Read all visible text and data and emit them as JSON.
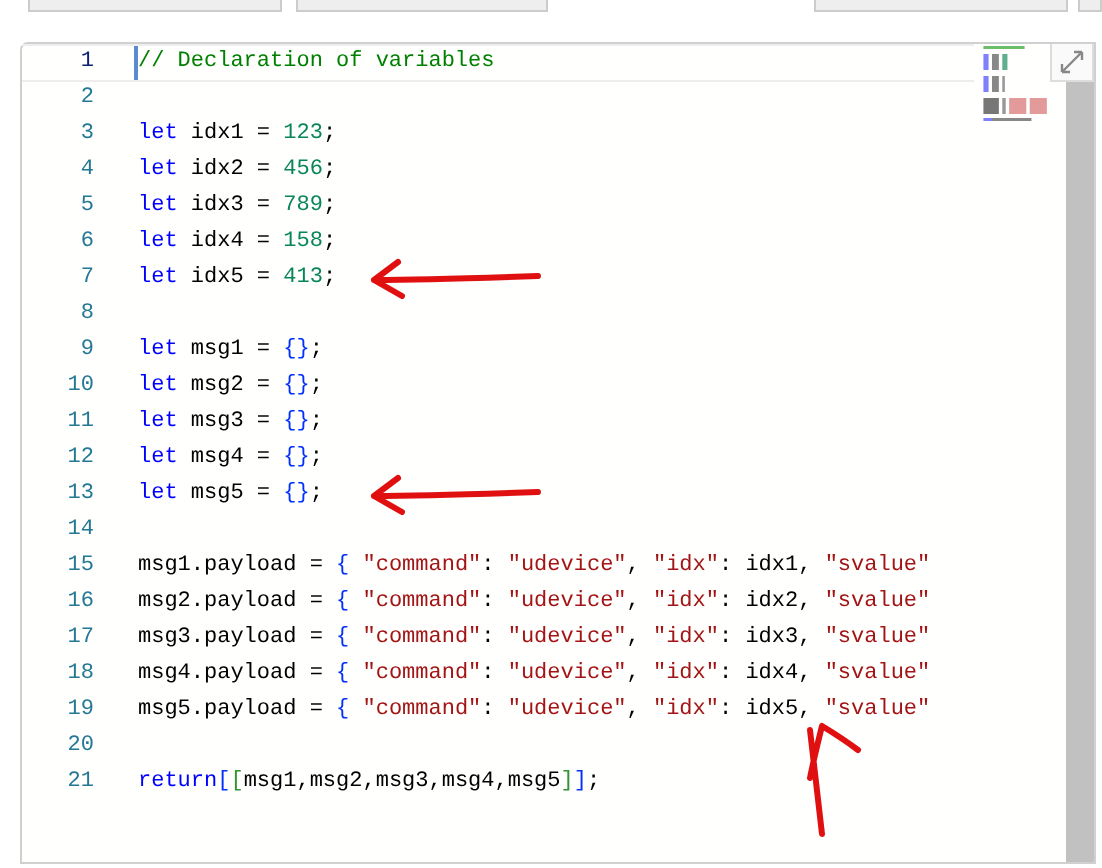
{
  "editor": {
    "lines": [
      {
        "number": "1",
        "active": true,
        "tokens": [
          {
            "kind": "comment",
            "text": "// Declaration of variables"
          }
        ]
      },
      {
        "number": "2",
        "active": false
      },
      {
        "number": "3",
        "active": false,
        "tokens": [
          {
            "kind": "keyword",
            "text": "let"
          },
          {
            "kind": "plain",
            "text": " idx1 = "
          },
          {
            "kind": "number",
            "text": "123"
          },
          {
            "kind": "plain",
            "text": ";"
          }
        ]
      },
      {
        "number": "4",
        "active": false,
        "tokens": [
          {
            "kind": "keyword",
            "text": "let"
          },
          {
            "kind": "plain",
            "text": " idx2 = "
          },
          {
            "kind": "number",
            "text": "456"
          },
          {
            "kind": "plain",
            "text": ";"
          }
        ]
      },
      {
        "number": "5",
        "active": false,
        "tokens": [
          {
            "kind": "keyword",
            "text": "let"
          },
          {
            "kind": "plain",
            "text": " idx3 = "
          },
          {
            "kind": "number",
            "text": "789"
          },
          {
            "kind": "plain",
            "text": ";"
          }
        ]
      },
      {
        "number": "6",
        "active": false,
        "tokens": [
          {
            "kind": "keyword",
            "text": "let"
          },
          {
            "kind": "plain",
            "text": " idx4 = "
          },
          {
            "kind": "number",
            "text": "158"
          },
          {
            "kind": "plain",
            "text": ";"
          }
        ]
      },
      {
        "number": "7",
        "active": false,
        "annotation": {
          "kind": "left-arrow"
        },
        "tokens": [
          {
            "kind": "keyword",
            "text": "let"
          },
          {
            "kind": "plain",
            "text": " idx5 = "
          },
          {
            "kind": "number",
            "text": "413"
          },
          {
            "kind": "plain",
            "text": ";"
          }
        ]
      },
      {
        "number": "8",
        "active": false
      },
      {
        "number": "9",
        "active": false,
        "tokens": [
          {
            "kind": "keyword",
            "text": "let"
          },
          {
            "kind": "plain",
            "text": " msg1 = "
          },
          {
            "kind": "brace",
            "text": "{}"
          },
          {
            "kind": "plain",
            "text": ";"
          }
        ]
      },
      {
        "number": "10",
        "active": false,
        "tokens": [
          {
            "kind": "keyword",
            "text": "let"
          },
          {
            "kind": "plain",
            "text": " msg2 = "
          },
          {
            "kind": "brace",
            "text": "{}"
          },
          {
            "kind": "plain",
            "text": ";"
          }
        ]
      },
      {
        "number": "11",
        "active": false,
        "tokens": [
          {
            "kind": "keyword",
            "text": "let"
          },
          {
            "kind": "plain",
            "text": " msg3 = "
          },
          {
            "kind": "brace",
            "text": "{}"
          },
          {
            "kind": "plain",
            "text": ";"
          }
        ]
      },
      {
        "number": "12",
        "active": false,
        "tokens": [
          {
            "kind": "keyword",
            "text": "let"
          },
          {
            "kind": "plain",
            "text": " msg4 = "
          },
          {
            "kind": "brace",
            "text": "{}"
          },
          {
            "kind": "plain",
            "text": ";"
          }
        ]
      },
      {
        "number": "13",
        "active": false,
        "annotation": {
          "kind": "left-arrow"
        },
        "tokens": [
          {
            "kind": "keyword",
            "text": "let"
          },
          {
            "kind": "plain",
            "text": " msg5 = "
          },
          {
            "kind": "brace",
            "text": "{}"
          },
          {
            "kind": "plain",
            "text": ";"
          }
        ]
      },
      {
        "number": "14",
        "active": false
      },
      {
        "number": "15",
        "active": false,
        "tokens": [
          {
            "kind": "plain",
            "text": "msg1.payload = "
          },
          {
            "kind": "brace",
            "text": "{"
          },
          {
            "kind": "string",
            "text": " \"command\""
          },
          {
            "kind": "plain",
            "text": ": "
          },
          {
            "kind": "string",
            "text": "\"udevice\""
          },
          {
            "kind": "plain",
            "text": ", "
          },
          {
            "kind": "string",
            "text": "\"idx\""
          },
          {
            "kind": "plain",
            "text": ": idx1, "
          },
          {
            "kind": "string",
            "text": "\"svalue\""
          }
        ]
      },
      {
        "number": "16",
        "active": false,
        "tokens": [
          {
            "kind": "plain",
            "text": "msg2.payload = "
          },
          {
            "kind": "brace",
            "text": "{"
          },
          {
            "kind": "string",
            "text": " \"command\""
          },
          {
            "kind": "plain",
            "text": ": "
          },
          {
            "kind": "string",
            "text": "\"udevice\""
          },
          {
            "kind": "plain",
            "text": ", "
          },
          {
            "kind": "string",
            "text": "\"idx\""
          },
          {
            "kind": "plain",
            "text": ": idx2, "
          },
          {
            "kind": "string",
            "text": "\"svalue\""
          }
        ]
      },
      {
        "number": "17",
        "active": false,
        "tokens": [
          {
            "kind": "plain",
            "text": "msg3.payload = "
          },
          {
            "kind": "brace",
            "text": "{"
          },
          {
            "kind": "string",
            "text": " \"command\""
          },
          {
            "kind": "plain",
            "text": ": "
          },
          {
            "kind": "string",
            "text": "\"udevice\""
          },
          {
            "kind": "plain",
            "text": ", "
          },
          {
            "kind": "string",
            "text": "\"idx\""
          },
          {
            "kind": "plain",
            "text": ": idx3, "
          },
          {
            "kind": "string",
            "text": "\"svalue\""
          }
        ]
      },
      {
        "number": "18",
        "active": false,
        "tokens": [
          {
            "kind": "plain",
            "text": "msg4.payload = "
          },
          {
            "kind": "brace",
            "text": "{"
          },
          {
            "kind": "string",
            "text": " \"command\""
          },
          {
            "kind": "plain",
            "text": ": "
          },
          {
            "kind": "string",
            "text": "\"udevice\""
          },
          {
            "kind": "plain",
            "text": ", "
          },
          {
            "kind": "string",
            "text": "\"idx\""
          },
          {
            "kind": "plain",
            "text": ": idx4, "
          },
          {
            "kind": "string",
            "text": "\"svalue\""
          }
        ]
      },
      {
        "number": "19",
        "active": false,
        "annotation": {
          "kind": "up-arrow"
        },
        "tokens": [
          {
            "kind": "plain",
            "text": "msg5.payload = "
          },
          {
            "kind": "brace",
            "text": "{"
          },
          {
            "kind": "string",
            "text": " \"command\""
          },
          {
            "kind": "plain",
            "text": ": "
          },
          {
            "kind": "string",
            "text": "\"udevice\""
          },
          {
            "kind": "plain",
            "text": ", "
          },
          {
            "kind": "string",
            "text": "\"idx\""
          },
          {
            "kind": "plain",
            "text": ": idx5, "
          },
          {
            "kind": "string",
            "text": "\"svalue\""
          }
        ]
      },
      {
        "number": "20",
        "active": false
      },
      {
        "number": "21",
        "active": false,
        "tokens": [
          {
            "kind": "keyword",
            "text": "return"
          },
          {
            "kind": "brace",
            "text": "["
          },
          {
            "kind": "bracket",
            "text": "["
          },
          {
            "kind": "plain",
            "text": "msg1,msg2,msg3,msg4,msg5"
          },
          {
            "kind": "bracket",
            "text": "]"
          },
          {
            "kind": "brace",
            "text": "]"
          },
          {
            "kind": "plain",
            "text": ";"
          }
        ]
      }
    ]
  }
}
